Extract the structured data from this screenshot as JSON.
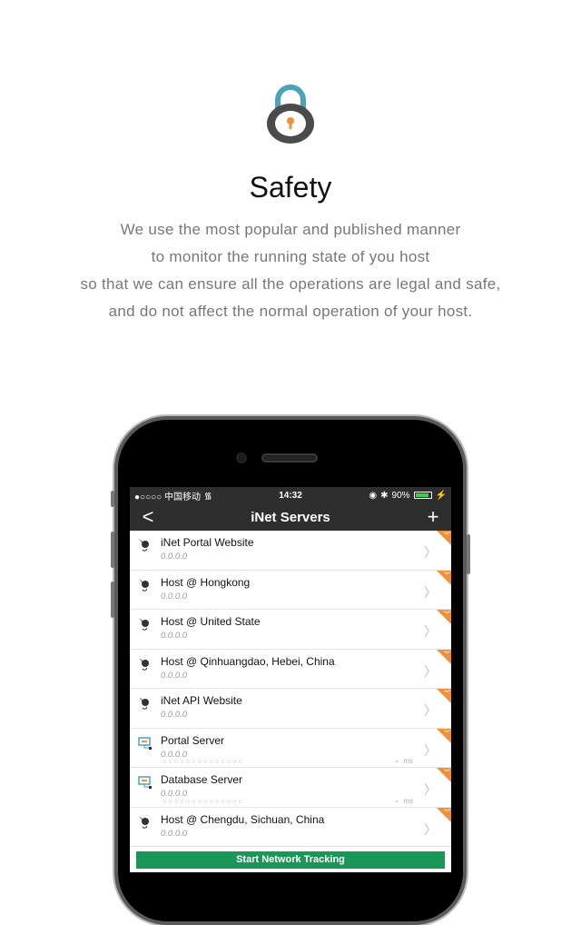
{
  "header": {
    "title": "Safety",
    "description": [
      "We use the most popular and published manner",
      "to monitor the running state of you host",
      "so that we can ensure all the operations are legal and safe,",
      "and do not affect the normal operation of your host."
    ]
  },
  "statusbar": {
    "carrier": "●○○○○ 中国移动",
    "time": "14:32",
    "battery": "90%",
    "battery_level": 0.9
  },
  "navbar": {
    "title": "iNet Servers",
    "back": "<",
    "add": "+"
  },
  "servers": [
    {
      "name": "iNet Portal Website",
      "ip": "0.0.0.0",
      "type": "host"
    },
    {
      "name": "Host @ Hongkong",
      "ip": "0.0.0.0",
      "type": "host"
    },
    {
      "name": "Host @ United State",
      "ip": "0.0.0.0",
      "type": "host"
    },
    {
      "name": "Host @ Qinhuangdao, Hebei, China",
      "ip": "0.0.0.0",
      "type": "host"
    },
    {
      "name": "iNet API Website",
      "ip": "0.0.0.0",
      "type": "host"
    },
    {
      "name": "Portal Server",
      "ip": "0.0.0.0",
      "type": "server",
      "dots": "○○○○○○○○○○○○○○",
      "latency": "-",
      "unit": "ms"
    },
    {
      "name": "Database Server",
      "ip": "0.0.0.0",
      "type": "server",
      "dots": "○○○○○○○○○○○○○○",
      "latency": "-",
      "unit": "ms"
    },
    {
      "name": "Host @ Chengdu, Sichuan, China",
      "ip": "0.0.0.0",
      "type": "host"
    }
  ],
  "action": {
    "label": "Start Network Tracking"
  },
  "colors": {
    "accent": "#f0913a",
    "green": "#1a9659",
    "bar": "#2e2e2e"
  }
}
